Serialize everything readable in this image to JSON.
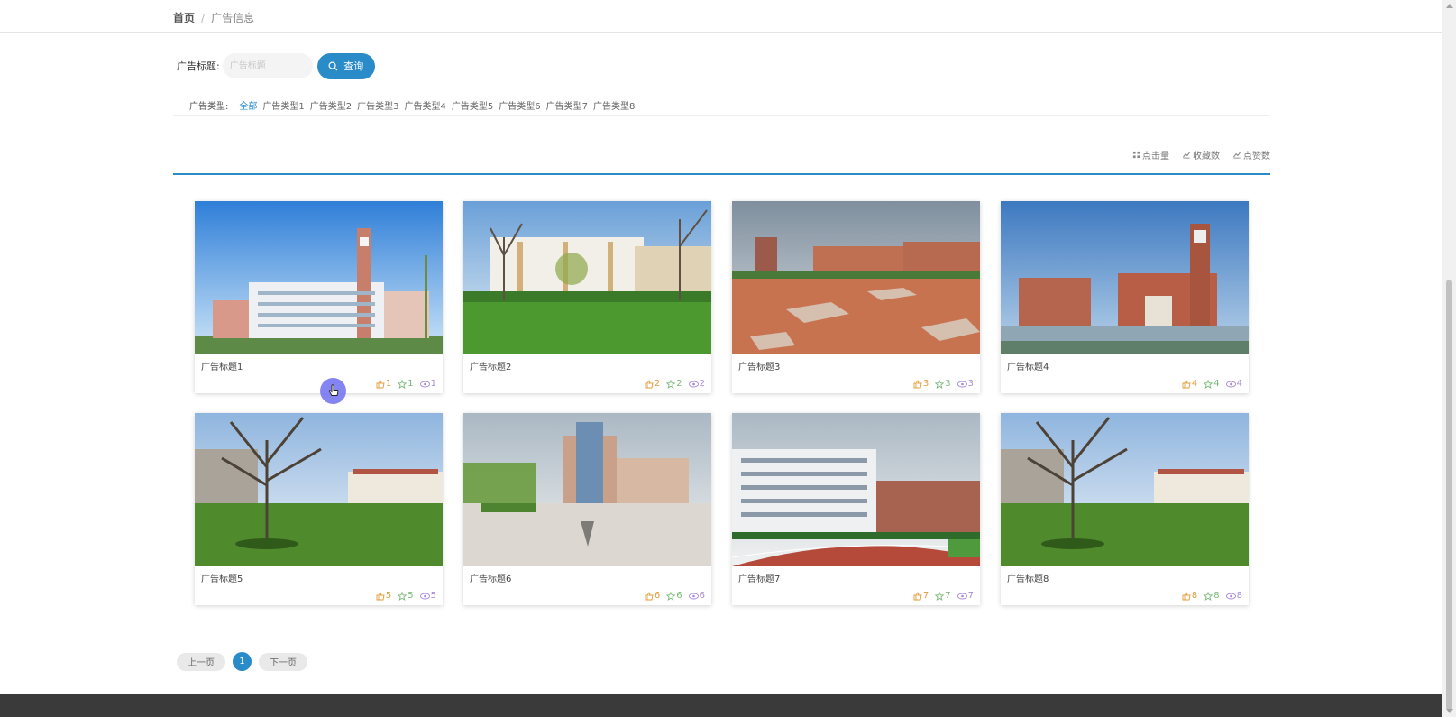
{
  "breadcrumb": {
    "home": "首页",
    "separator": "/",
    "current": "广告信息"
  },
  "search": {
    "label": "广告标题:",
    "placeholder": "广告标题",
    "button_label": "查询",
    "button_icon": "search-icon"
  },
  "types": {
    "label": "广告类型:",
    "items": [
      "全部",
      "广告类型1",
      "广告类型2",
      "广告类型3",
      "广告类型4",
      "广告类型5",
      "广告类型6",
      "广告类型7",
      "广告类型8"
    ],
    "active_index": 0
  },
  "sort": {
    "items": [
      "点击量",
      "收藏数",
      "点赞数"
    ]
  },
  "cards": [
    {
      "title": "广告标题1",
      "likes": "1",
      "favorites": "1",
      "views": "1",
      "image": "modern-school-campus-clock-tower"
    },
    {
      "title": "广告标题2",
      "likes": "2",
      "favorites": "2",
      "views": "2",
      "image": "campus-lawn-trees"
    },
    {
      "title": "广告标题3",
      "likes": "3",
      "favorites": "3",
      "views": "3",
      "image": "campus-plaza"
    },
    {
      "title": "广告标题4",
      "likes": "4",
      "favorites": "4",
      "views": "4",
      "image": "brick-building-clock-tower"
    },
    {
      "title": "广告标题5",
      "likes": "5",
      "favorites": "5",
      "views": "5",
      "image": "campus-big-tree-lawn"
    },
    {
      "title": "广告标题6",
      "likes": "6",
      "favorites": "6",
      "views": "6",
      "image": "campus-plaza-building"
    },
    {
      "title": "广告标题7",
      "likes": "7",
      "favorites": "7",
      "views": "7",
      "image": "school-running-track"
    },
    {
      "title": "广告标题8",
      "likes": "8",
      "favorites": "8",
      "views": "8",
      "image": "campus-big-tree-lawn"
    }
  ],
  "pagination": {
    "prev": "上一页",
    "current": "1",
    "next": "下一页"
  },
  "colors": {
    "accent": "#2a8bc9",
    "like": "#e39b3a",
    "favorite": "#7ab87a",
    "view": "#a88ad9",
    "footer": "#3a3a3a"
  }
}
